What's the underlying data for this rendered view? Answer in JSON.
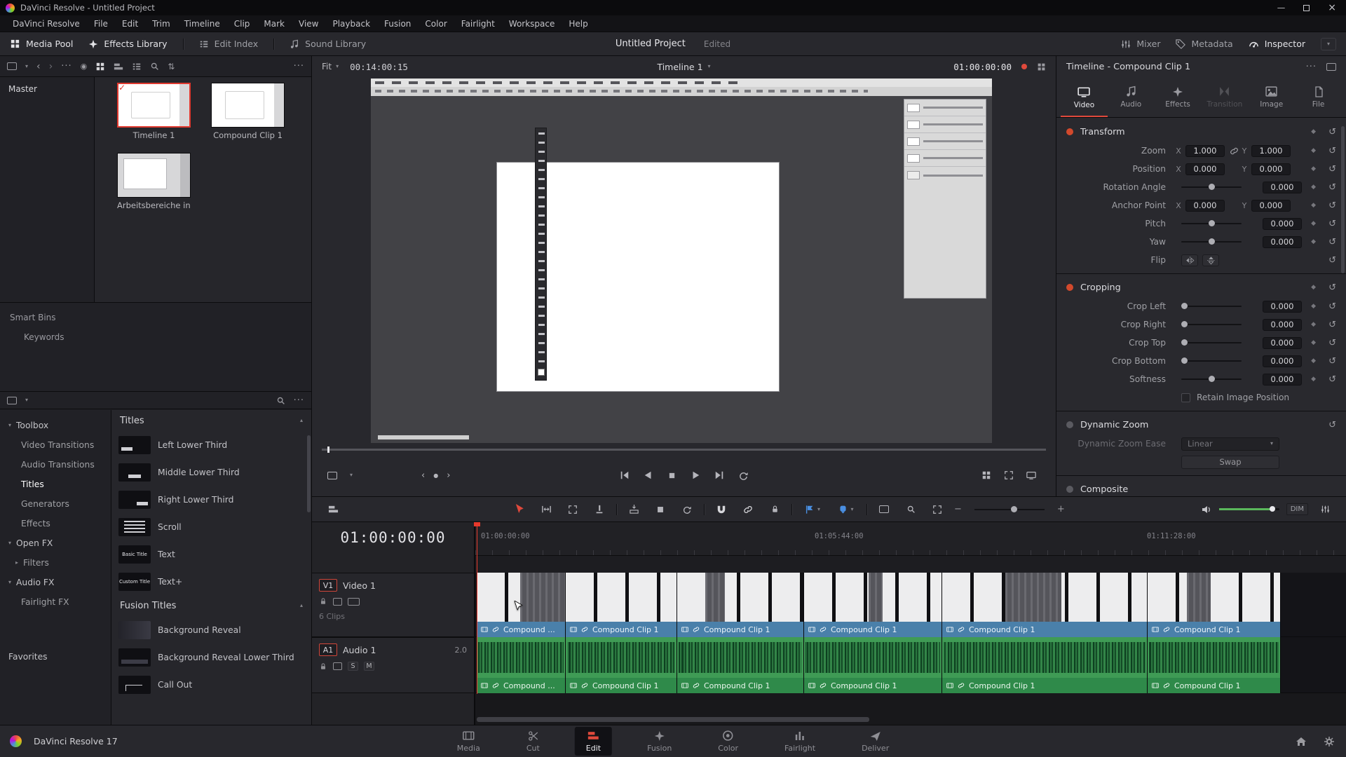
{
  "app": {
    "window_title": "DaVinci Resolve - Untitled Project",
    "version_label": "DaVinci Resolve 17"
  },
  "colors": {
    "accent_red": "#e0493c",
    "clip_label_blue": "#4a80aa",
    "audio_green": "#3f9b55",
    "flag_blue": "#4a8fe2"
  },
  "menubar": {
    "items": [
      "DaVinci Resolve",
      "File",
      "Edit",
      "Trim",
      "Timeline",
      "Clip",
      "Mark",
      "View",
      "Playback",
      "Fusion",
      "Color",
      "Fairlight",
      "Workspace",
      "Help"
    ]
  },
  "toolbar": {
    "media_pool": "Media Pool",
    "effects_library": "Effects Library",
    "edit_index": "Edit Index",
    "sound_library": "Sound Library",
    "project_title": "Untitled Project",
    "project_status": "Edited",
    "mixer": "Mixer",
    "metadata": "Metadata",
    "inspector": "Inspector"
  },
  "media_pool": {
    "bin_master": "Master",
    "clips": [
      {
        "name": "Timeline 1"
      },
      {
        "name": "Compound Clip 1"
      },
      {
        "name": "Arbeitsbereiche in..."
      }
    ],
    "smart_bins": "Smart Bins",
    "keywords": "Keywords"
  },
  "effects_sidebar": {
    "toolbox": "Toolbox",
    "items": [
      "Video Transitions",
      "Audio Transitions",
      "Titles",
      "Generators",
      "Effects"
    ],
    "open_fx": "Open FX",
    "filters": "Filters",
    "audio_fx": "Audio FX",
    "fairlight_fx": "Fairlight FX",
    "favorites": "Favorites"
  },
  "titles_panel": {
    "header": "Titles",
    "items": [
      "Left Lower Third",
      "Middle Lower Third",
      "Right Lower Third",
      "Scroll",
      "Text",
      "Text+"
    ],
    "text_thumb": "Basic Title",
    "text_plus_thumb": "Custom Title",
    "fusion_header": "Fusion Titles",
    "fusion_items": [
      "Background Reveal",
      "Background Reveal Lower Third",
      "Call Out"
    ]
  },
  "viewer": {
    "zoom_mode": "Fit",
    "clip_timecode": "00:14:00:15",
    "timeline_name": "Timeline 1",
    "timecode": "01:00:00:00"
  },
  "inspector": {
    "header": "Timeline - Compound Clip 1",
    "tabs": [
      "Video",
      "Audio",
      "Effects",
      "Transition",
      "Image",
      "File"
    ],
    "axis": {
      "x": "X",
      "y": "Y"
    },
    "transform": {
      "title": "Transform",
      "zoom_label": "Zoom",
      "zoom_x": "1.000",
      "zoom_y": "1.000",
      "position_label": "Position",
      "position_x": "0.000",
      "position_y": "0.000",
      "rotation_label": "Rotation Angle",
      "rotation_value": "0.000",
      "anchor_label": "Anchor Point",
      "anchor_x": "0.000",
      "anchor_y": "0.000",
      "pitch_label": "Pitch",
      "pitch_value": "0.000",
      "yaw_label": "Yaw",
      "yaw_value": "0.000",
      "flip_label": "Flip"
    },
    "cropping": {
      "title": "Cropping",
      "crop_left_label": "Crop Left",
      "crop_left_value": "0.000",
      "crop_right_label": "Crop Right",
      "crop_right_value": "0.000",
      "crop_top_label": "Crop Top",
      "crop_top_value": "0.000",
      "crop_bottom_label": "Crop Bottom",
      "crop_bottom_value": "0.000",
      "softness_label": "Softness",
      "softness_value": "0.000",
      "retain_label": "Retain Image Position"
    },
    "dynamic_zoom": {
      "title": "Dynamic Zoom",
      "ease_label": "Dynamic Zoom Ease",
      "ease_value": "Linear",
      "swap_label": "Swap"
    },
    "composite": {
      "title": "Composite"
    }
  },
  "timeline": {
    "timecode": "01:00:00:00",
    "ruler": [
      "01:00:00:00",
      "01:05:44:00",
      "01:11:28:00"
    ],
    "video_track": {
      "badge": "V1",
      "name": "Video 1",
      "clip_count": "6 Clips"
    },
    "audio_track": {
      "badge": "A1",
      "name": "Audio 1",
      "format": "2.0",
      "solo": "S",
      "mute": "M"
    },
    "video_clips": [
      "Compound ...",
      "Compound Clip 1",
      "Compound Clip 1",
      "Compound Clip 1",
      "Compound Clip 1",
      "Compound Clip 1"
    ],
    "audio_clips": [
      "Compound ...",
      "Compound Clip 1",
      "Compound Clip 1",
      "Compound Clip 1",
      "Compound Clip 1",
      "Compound Clip 1"
    ],
    "dim_button": "DIM"
  },
  "bottom_nav": {
    "pages": [
      "Media",
      "Cut",
      "Edit",
      "Fusion",
      "Color",
      "Fairlight",
      "Deliver"
    ],
    "active_page": "Edit"
  }
}
